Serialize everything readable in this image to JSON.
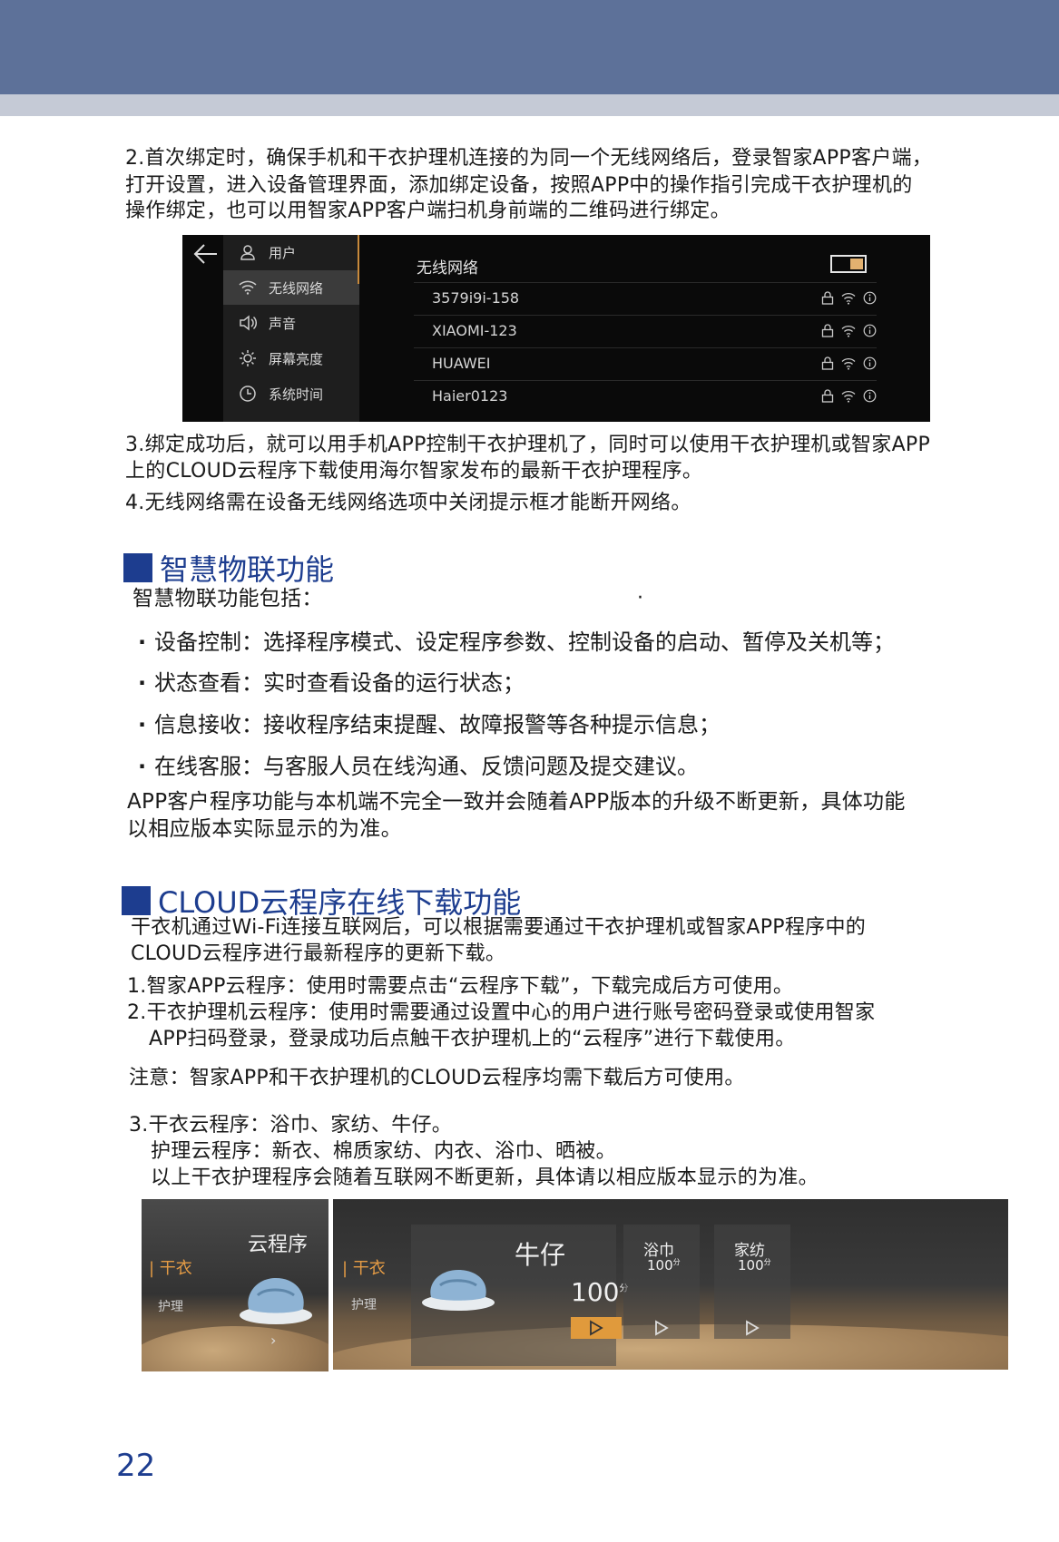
{
  "page_number": "22",
  "intro": [
    "2.首次绑定时，确保手机和干衣护理机连接的为同一个无线网络后，登录智家APP客户端，",
    "打开设置，进入设备管理界面，添加绑定设备，按照APP中的操作指引完成干衣护理机的",
    "操作绑定，也可以用智家APP客户端扫机身前端的二维码进行绑定。"
  ],
  "wifi_screen": {
    "menu": [
      "用户",
      "无线网络",
      "声音",
      "屏幕亮度",
      "系统时间"
    ],
    "menu_icons": [
      "user-icon",
      "wifi-icon",
      "speaker-icon",
      "brightness-icon",
      "clock-icon"
    ],
    "active_index": 1,
    "title": "无线网络",
    "toggle_on": true,
    "networks": [
      "3579i9i-158",
      "XIAOMI-123",
      "HUAWEI",
      "Haier0123"
    ],
    "accent": "#e2b170"
  },
  "after": [
    "3.绑定成功后，就可以用手机APP控制干衣护理机了，同时可以使用干衣护理机或智家APP",
    "上的CLOUD云程序下载使用海尔智家发布的最新干衣护理程序。",
    "4.无线网络需在设备无线网络选项中关闭提示框才能断开网络。"
  ],
  "section1": {
    "title": "智慧物联功能",
    "lead": "智慧物联功能包括：",
    "stray_mark": "·",
    "bullets": [
      "设备控制：选择程序模式、设定程序参数、控制设备的启动、暂停及关机等；",
      "状态查看：实时查看设备的运行状态；",
      "信息接收：接收程序结束提醒、故障报警等各种提示信息；",
      "在线客服：与客服人员在线沟通、反馈问题及提交建议。"
    ],
    "note": [
      "APP客户程序功能与本机端不完全一致并会随着APP版本的升级不断更新，具体功能",
      "以相应版本实际显示的为准。"
    ]
  },
  "section2": {
    "title": "CLOUD云程序在线下载功能",
    "lead": [
      "干衣机通过Wi-Fi连接互联网后，可以根据需要通过干衣护理机或智家APP程序中的",
      "CLOUD云程序进行最新程序的更新下载。"
    ],
    "items": [
      "1.智家APP云程序：使用时需要点击“云程序下载”，下载完成后方可使用。",
      "2.干衣护理机云程序：使用时需要通过设置中心的用户进行账号密码登录或使用智家",
      "APP扫码登录，登录成功后点触干衣护理机上的“云程序”进行下载使用。"
    ],
    "notice": "注意：智家APP和干衣护理机的CLOUD云程序均需下载后方可使用。",
    "list3": [
      "3.干衣云程序：浴巾、家纺、牛仔。",
      "护理云程序：新衣、棉质家纺、内衣、浴巾、晒被。",
      "以上干衣护理程序会随着互联网不断更新，具体请以相应版本显示的为准。"
    ]
  },
  "cloud_screen": {
    "left": {
      "tab_dry": "干衣",
      "tab_care": "护理",
      "title": "云程序"
    },
    "right": {
      "tab_dry": "干衣",
      "tab_care": "护理",
      "main_program": "牛仔",
      "main_time": "100",
      "unit": "分",
      "cards": [
        {
          "name": "浴巾",
          "time": "100",
          "unit": "分"
        },
        {
          "name": "家纺",
          "time": "100",
          "unit": "分"
        }
      ]
    }
  }
}
